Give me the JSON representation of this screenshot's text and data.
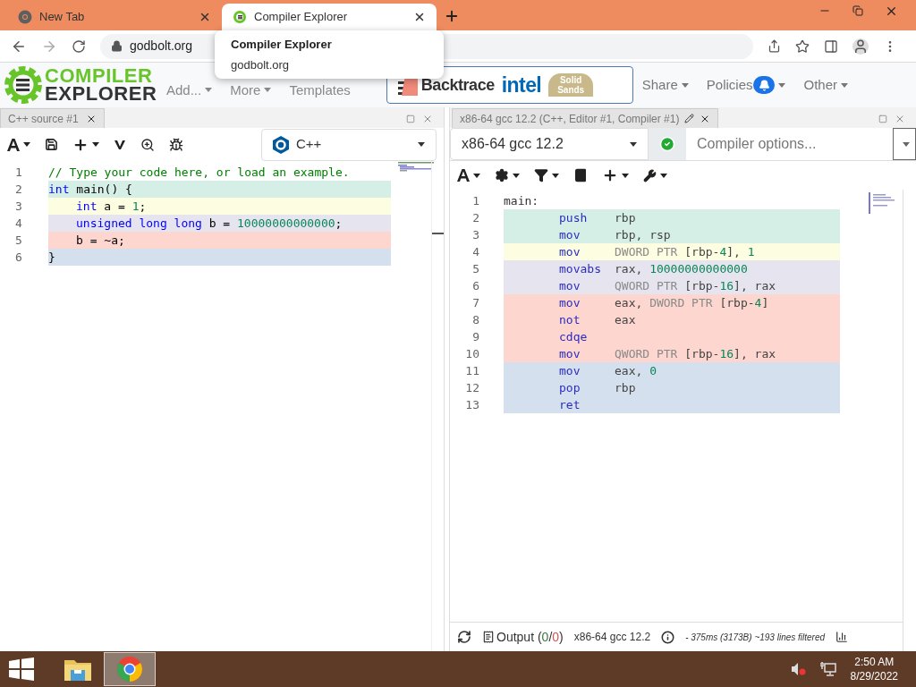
{
  "browser": {
    "tabs": [
      {
        "title": "New Tab",
        "kind": "chrome",
        "selected": false
      },
      {
        "title": "Compiler Explorer",
        "kind": "ce",
        "selected": true
      }
    ],
    "url": "godbolt.org",
    "tooltip": {
      "title": "Compiler Explorer",
      "url": "godbolt.org"
    }
  },
  "navbar": {
    "logo": [
      "COMPILER",
      "EXPLORER"
    ],
    "menus": [
      {
        "label": "Add...",
        "caret": true
      },
      {
        "label": "More",
        "caret": true
      },
      {
        "label": "Templates",
        "caret": false
      }
    ],
    "sponsors": {
      "backtrace": "Backtrace",
      "intel": "intel",
      "solid": "Solid",
      "sands": "Sands"
    },
    "right_menus": [
      {
        "label": "Share",
        "bell": false
      },
      {
        "label": "Policies",
        "bell": true
      },
      {
        "label": "Other",
        "bell": false
      }
    ]
  },
  "editor": {
    "tab": "C++ source #1",
    "language": "C++",
    "lines": [
      {
        "number": "1",
        "indented": false,
        "tokens": [
          {
            "text": "// Type your code here, or load an example.",
            "kind": "comment"
          }
        ]
      },
      {
        "number": "2",
        "indented": false,
        "color": "#d5efe6",
        "tokens": [
          {
            "text": "int",
            "kind": "kw"
          },
          {
            "text": " main() {",
            "kind": "plain"
          }
        ]
      },
      {
        "number": "3",
        "indented": true,
        "color": "#fdfde1",
        "tokens": [
          {
            "text": "int",
            "kind": "kw"
          },
          {
            "text": " a = ",
            "kind": "plain"
          },
          {
            "text": "1",
            "kind": "num"
          },
          {
            "text": ";",
            "kind": "plain"
          }
        ]
      },
      {
        "number": "4",
        "indented": true,
        "color": "#e6e4ef",
        "tokens": [
          {
            "text": "unsigned long long",
            "kind": "kw"
          },
          {
            "text": " b = ",
            "kind": "plain"
          },
          {
            "text": "10000000000000",
            "kind": "num"
          },
          {
            "text": ";",
            "kind": "plain"
          }
        ]
      },
      {
        "number": "5",
        "indented": true,
        "color": "#fcd6cf",
        "tokens": [
          {
            "text": "b = ~a;",
            "kind": "plain"
          }
        ]
      },
      {
        "number": "6",
        "indented": false,
        "color": "#d4e0ee",
        "tokens": [
          {
            "text": "}",
            "kind": "plain"
          }
        ]
      }
    ]
  },
  "compiler": {
    "tab": "x86-64 gcc 12.2 (C++, Editor #1, Compiler #1)",
    "compiler": "x86-64 gcc 12.2",
    "ok": true,
    "options_placeholder": "Compiler options...",
    "lines": [
      {
        "number": "1",
        "kind": "label",
        "label": "main:"
      },
      {
        "number": "2",
        "kind": "instr",
        "color": "#d5efe6",
        "opcode": "push",
        "operands": [
          {
            "text": "rbp",
            "kind": "reg"
          }
        ]
      },
      {
        "number": "3",
        "kind": "instr",
        "color": "#d5efe6",
        "opcode": "mov",
        "operands": [
          {
            "text": "rbp, rsp",
            "kind": "reg"
          }
        ]
      },
      {
        "number": "4",
        "kind": "instr",
        "color": "#fdfde1",
        "opcode": "mov",
        "operands": [
          {
            "text": "DWORD PTR ",
            "kind": "ptr"
          },
          {
            "text": "[rbp-",
            "kind": "reg"
          },
          {
            "text": "4",
            "kind": "num"
          },
          {
            "text": "], ",
            "kind": "reg"
          },
          {
            "text": "1",
            "kind": "num"
          }
        ]
      },
      {
        "number": "5",
        "kind": "instr",
        "color": "#e6e4ef",
        "opcode": "movabs",
        "operands": [
          {
            "text": "rax, ",
            "kind": "reg"
          },
          {
            "text": "10000000000000",
            "kind": "num"
          }
        ]
      },
      {
        "number": "6",
        "kind": "instr",
        "color": "#e6e4ef",
        "opcode": "mov",
        "operands": [
          {
            "text": "QWORD PTR ",
            "kind": "ptr"
          },
          {
            "text": "[rbp-",
            "kind": "reg"
          },
          {
            "text": "16",
            "kind": "num"
          },
          {
            "text": "], rax",
            "kind": "reg"
          }
        ]
      },
      {
        "number": "7",
        "kind": "instr",
        "color": "#fcd6cf",
        "opcode": "mov",
        "operands": [
          {
            "text": "eax, ",
            "kind": "reg"
          },
          {
            "text": "DWORD PTR ",
            "kind": "ptr"
          },
          {
            "text": "[rbp-",
            "kind": "reg"
          },
          {
            "text": "4",
            "kind": "num"
          },
          {
            "text": "]",
            "kind": "reg"
          }
        ]
      },
      {
        "number": "8",
        "kind": "instr",
        "color": "#fcd6cf",
        "opcode": "not",
        "operands": [
          {
            "text": "eax",
            "kind": "reg"
          }
        ]
      },
      {
        "number": "9",
        "kind": "instr",
        "color": "#fcd6cf",
        "opcode": "cdqe"
      },
      {
        "number": "10",
        "kind": "instr",
        "color": "#fcd6cf",
        "opcode": "mov",
        "operands": [
          {
            "text": "QWORD PTR ",
            "kind": "ptr"
          },
          {
            "text": "[rbp-",
            "kind": "reg"
          },
          {
            "text": "16",
            "kind": "num"
          },
          {
            "text": "], rax",
            "kind": "reg"
          }
        ]
      },
      {
        "number": "11",
        "kind": "instr",
        "color": "#d4e0ee",
        "opcode": "mov",
        "operands": [
          {
            "text": "eax, ",
            "kind": "reg"
          },
          {
            "text": "0",
            "kind": "num"
          }
        ]
      },
      {
        "number": "12",
        "kind": "instr",
        "color": "#d4e0ee",
        "opcode": "pop",
        "operands": [
          {
            "text": "rbp",
            "kind": "reg"
          }
        ]
      },
      {
        "number": "13",
        "kind": "instr",
        "color": "#d4e0ee",
        "opcode": "ret"
      }
    ],
    "status": {
      "output": [
        {
          "text": "Output (",
          "kind": "plain"
        },
        {
          "text": "0",
          "kind": "ok"
        },
        {
          "text": "/",
          "kind": "plain"
        },
        {
          "text": "0",
          "kind": "error"
        },
        {
          "text": ")",
          "kind": "plain"
        }
      ],
      "compiler": "x86-64 gcc 12.2",
      "timing": "- 375ms (3173B) ~193 lines filtered"
    }
  },
  "taskbar": {
    "apps": [
      {
        "kind": "explorer",
        "selected": false
      },
      {
        "kind": "chrome",
        "selected": true
      }
    ],
    "time": "2:50 AM",
    "date": "8/29/2022"
  }
}
